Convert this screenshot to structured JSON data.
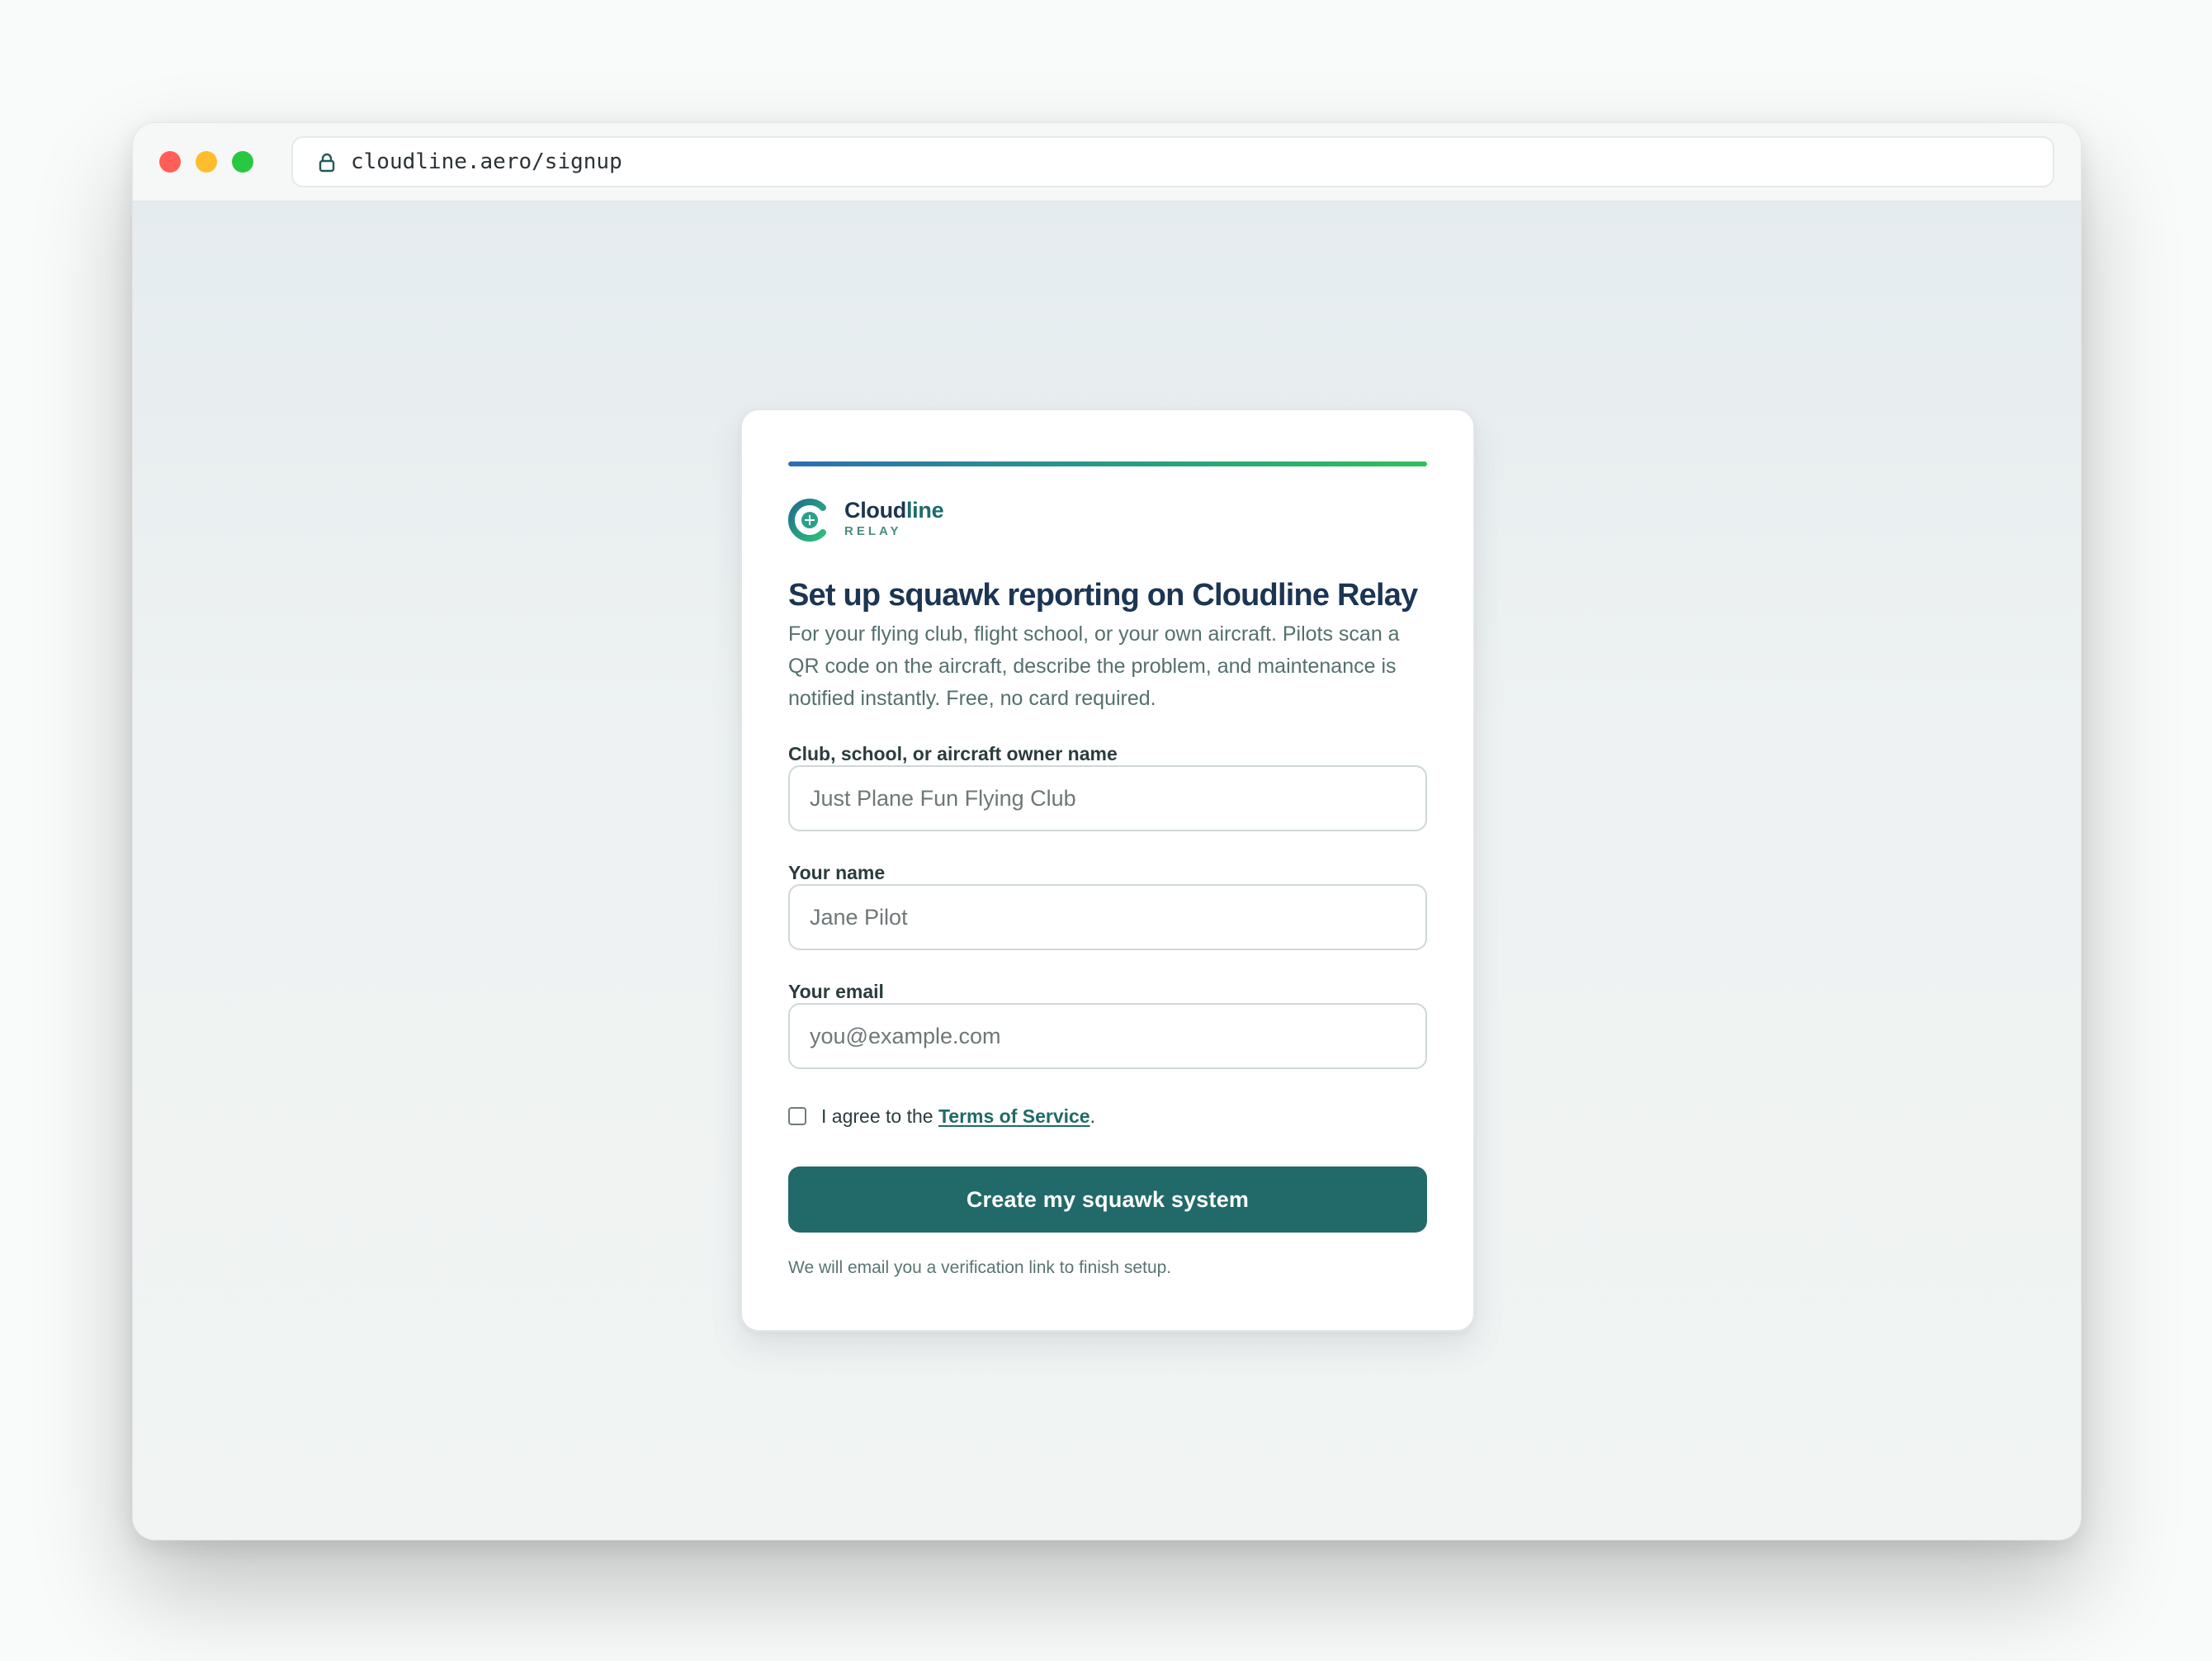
{
  "browser": {
    "url": "cloudline.aero/signup"
  },
  "brand": {
    "name_primary": "Cloud",
    "name_accent": "line",
    "subtitle": "RELAY"
  },
  "signup": {
    "headline": "Set up squawk reporting on Cloudline Relay",
    "intro": "For your flying club, flight school, or your own aircraft. Pilots scan a QR code on the aircraft, describe the problem, and maintenance is notified instantly. Free, no card required.",
    "fields": {
      "org": {
        "label": "Club, school, or aircraft owner name",
        "value": "",
        "placeholder": "Just Plane Fun Flying Club"
      },
      "name": {
        "label": "Your name",
        "value": "",
        "placeholder": "Jane Pilot"
      },
      "email": {
        "label": "Your email",
        "value": "",
        "placeholder": "you@example.com"
      }
    },
    "terms": {
      "prefix": "I agree to the ",
      "link": "Terms of Service",
      "suffix": ".",
      "checked": false
    },
    "submit_label": "Create my squawk system",
    "footnote": "We will email you a verification link to finish setup."
  },
  "colors": {
    "primary": "#216a69",
    "heading": "#1c3552",
    "accent_gradient": [
      "#2c6fb4",
      "#30c05a"
    ]
  },
  "icons": {
    "url_lock": "lock-icon",
    "logo": "cloudline-logo-icon"
  }
}
